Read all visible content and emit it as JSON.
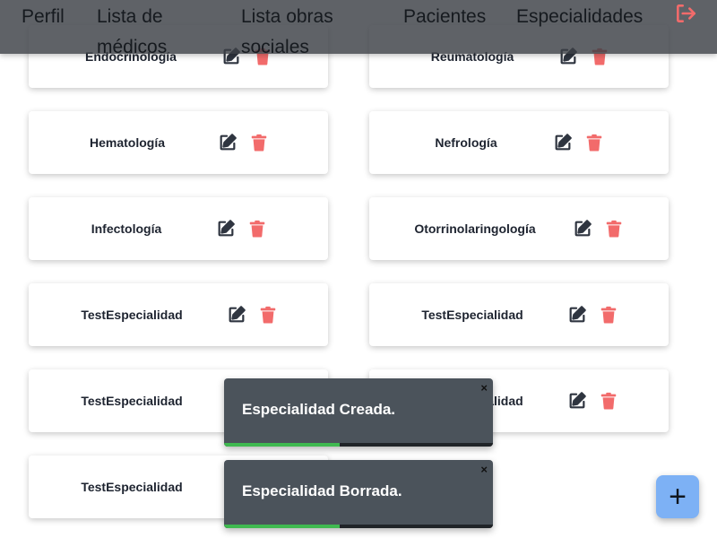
{
  "nav": {
    "items": [
      "Perfil",
      "Lista de médicos",
      "Lista obras sociales",
      "Pacientes",
      "Especialidades"
    ],
    "logout_icon": "logout-icon",
    "logout_color": "#f26b6b"
  },
  "specialties": [
    "Endocrinología",
    "Reumatología",
    "Hematología",
    "Nefrología",
    "Infectología",
    "Otorrinolaringología",
    "TestEspecialidad",
    "TestEspecialidad",
    "TestEspecialidad",
    "TestEspecialidad",
    "TestEspecialidad"
  ],
  "card_actions": {
    "edit_icon": "edit-icon",
    "delete_icon": "trash-icon",
    "edit_color": "#2f3540",
    "delete_color": "#f26b6b"
  },
  "toasts": [
    {
      "message": "Especialidad Creada.",
      "close": "×",
      "progress": 0.43
    },
    {
      "message": "Especialidad Borrada.",
      "close": "×",
      "progress": 0.43
    }
  ],
  "fab": {
    "label": "+",
    "color": "#7db1f5"
  },
  "colors": {
    "toast_bg": "#4b535b",
    "progress": "#3fb950"
  }
}
